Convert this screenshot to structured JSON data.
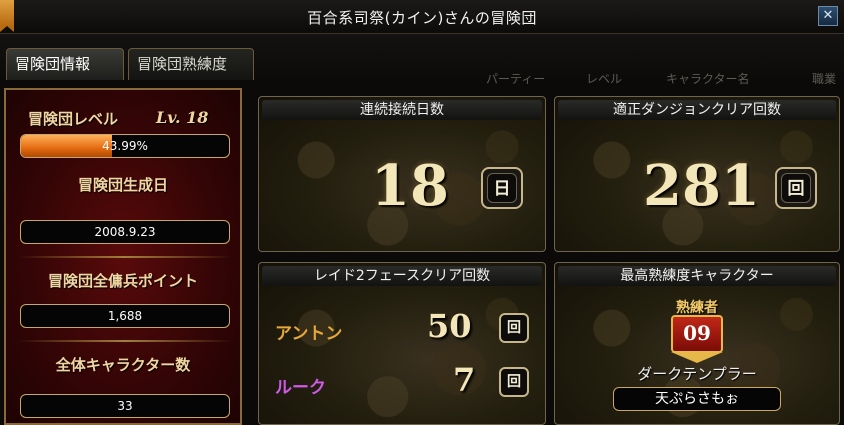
{
  "window": {
    "title": "百合系司祭(カイン)さんの冒険団"
  },
  "tabs": [
    {
      "label": "冒険団情報",
      "active": true
    },
    {
      "label": "冒険団熟練度",
      "active": false
    }
  ],
  "background_columns": [
    "パーティー",
    "レベル",
    "キャラクター名",
    "職業"
  ],
  "adventure_team": {
    "level_label": "冒険団レベル",
    "level_value": "Lv. 18",
    "exp_percent_text": "43.99%",
    "exp_fraction": 0.4399,
    "created_label": "冒険団生成日",
    "created_date": "2008.9.23",
    "mercenary_label": "冒険団全傭兵ポイント",
    "mercenary_points": "1,688",
    "char_count_label": "全体キャラクター数",
    "char_count": "33"
  },
  "stats": {
    "login_days_title": "連続接続日数",
    "login_days_value": "18",
    "login_days_unit": "日",
    "dungeon_clear_title": "適正ダンジョンクリア回数",
    "dungeon_clear_value": "281",
    "dungeon_clear_unit": "回"
  },
  "raid": {
    "title": "レイド2フェースクリア回数",
    "entries": [
      {
        "name": "アントン",
        "value": "50",
        "unit": "回",
        "color": "#e8a83a"
      },
      {
        "name": "ルーク",
        "value": "7",
        "unit": "回",
        "color": "#d05ae8"
      }
    ]
  },
  "best_character": {
    "title": "最高熟練度キャラクター",
    "rank_label": "熟練者",
    "rank_number": "09",
    "class_name": "ダークテンプラー",
    "character_name": "天ぷらさもぉ"
  }
}
